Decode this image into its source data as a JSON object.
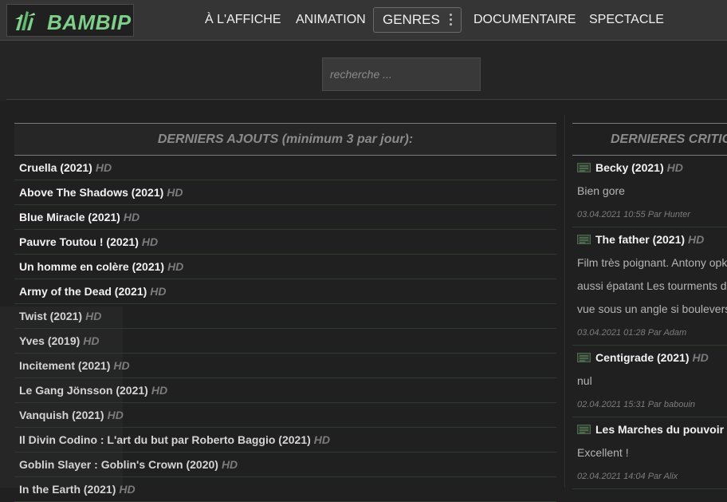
{
  "header": {
    "logo_text": "BAMBIP",
    "nav": [
      {
        "label": "À L'AFFICHE"
      },
      {
        "label": "ANIMATION"
      },
      {
        "label": "GENRES"
      },
      {
        "label": "DOCUMENTAIRE"
      },
      {
        "label": "SPECTACLE"
      }
    ]
  },
  "search": {
    "placeholder": "recherche ..."
  },
  "latest": {
    "title": "DERNIERS AJOUTS (minimum 3 par jour):",
    "items": [
      {
        "title": "Cruella (2021)",
        "quality": "HD"
      },
      {
        "title": "Above The Shadows (2021)",
        "quality": "HD"
      },
      {
        "title": "Blue Miracle (2021)",
        "quality": "HD"
      },
      {
        "title": "Pauvre Toutou ! (2021)",
        "quality": "HD"
      },
      {
        "title": "Un homme en colère (2021)",
        "quality": "HD"
      },
      {
        "title": "Army of the Dead (2021)",
        "quality": "HD"
      },
      {
        "title": "Twist (2021)",
        "quality": "HD"
      },
      {
        "title": "Yves (2019)",
        "quality": "HD"
      },
      {
        "title": "Incitement (2021)",
        "quality": "HD"
      },
      {
        "title": "Le Gang Jönsson (2021)",
        "quality": "HD"
      },
      {
        "title": "Vanquish (2021)",
        "quality": "HD"
      },
      {
        "title": "Il Divin Codino : L'art du but par Roberto Baggio (2021)",
        "quality": "HD"
      },
      {
        "title": "Goblin Slayer : Goblin's Crown (2020)",
        "quality": "HD"
      },
      {
        "title": "In the Earth (2021)",
        "quality": "HD"
      }
    ]
  },
  "reviews": {
    "title": "DERNIERES CRITIC",
    "items": [
      {
        "title": "Becky (2021)",
        "quality": "HD",
        "lines": [
          "Bien gore"
        ],
        "meta": "03.04.2021 10:55 Par Hunter"
      },
      {
        "title": "The father (2021)",
        "quality": "HD",
        "lines": [
          "Film très poignant. Antony opk",
          "aussi épatant Les tourments d",
          "vue sous un angle si boulevers"
        ],
        "meta": "03.04.2021 01:28 Par Adam"
      },
      {
        "title": "Centigrade (2021)",
        "quality": "HD",
        "lines": [
          "nul"
        ],
        "meta": "02.04.2021 15:31 Par babouin"
      },
      {
        "title": "Les Marches du pouvoir",
        "quality": "",
        "lines": [
          "Excellent !"
        ],
        "meta": "02.04.2021 14:04 Par Alix"
      }
    ]
  },
  "colors": {
    "accent": "#7dcf8a",
    "background": "#202020",
    "topbar": "#353535"
  }
}
